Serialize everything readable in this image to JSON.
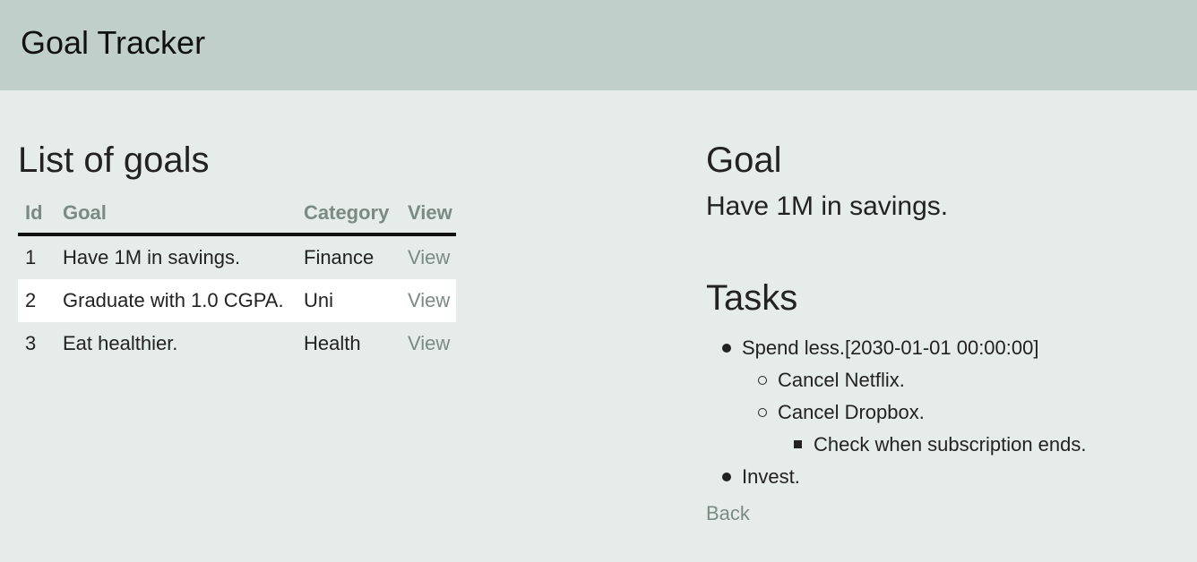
{
  "header": {
    "title": "Goal Tracker"
  },
  "goals_list": {
    "heading": "List of goals",
    "columns": {
      "id": "Id",
      "goal": "Goal",
      "category": "Category",
      "view": "View"
    },
    "rows": [
      {
        "id": "1",
        "goal": "Have 1M in savings.",
        "category": "Finance",
        "view": "View"
      },
      {
        "id": "2",
        "goal": "Graduate with 1.0 CGPA.",
        "category": "Uni",
        "view": "View"
      },
      {
        "id": "3",
        "goal": "Eat healthier.",
        "category": "Health",
        "view": "View"
      }
    ]
  },
  "goal_detail": {
    "heading": "Goal",
    "text": "Have 1M in savings.",
    "tasks_heading": "Tasks",
    "tasks": [
      {
        "label": "Spend less.[2030-01-01 00:00:00]",
        "subtasks": [
          {
            "label": "Cancel Netflix."
          },
          {
            "label": "Cancel Dropbox.",
            "subtasks": [
              {
                "label": "Check when subscription ends."
              }
            ]
          }
        ]
      },
      {
        "label": "Invest."
      }
    ],
    "back_label": "Back"
  },
  "colors": {
    "header_bg": "#c1cfca",
    "page_bg": "#e6ecea",
    "muted_link": "#7b8a83",
    "highlight_row": "#ffffff"
  }
}
